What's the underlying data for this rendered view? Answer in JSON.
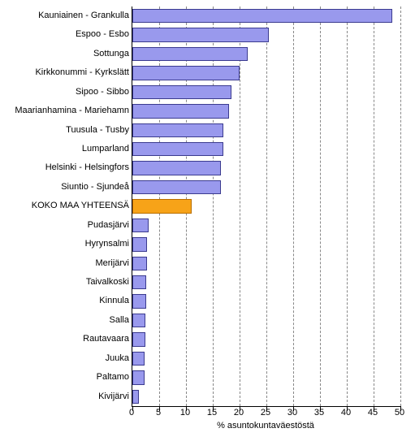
{
  "chart_data": {
    "type": "bar",
    "orientation": "horizontal",
    "xlabel": "% asuntokuntaväestöstä",
    "ylabel": "",
    "xlim": [
      0,
      50
    ],
    "xticks": [
      0,
      5,
      10,
      15,
      20,
      25,
      30,
      35,
      40,
      45,
      50
    ],
    "categories": [
      "Kauniainen - Grankulla",
      "Espoo - Esbo",
      "Sottunga",
      "Kirkkonummi - Kyrkslätt",
      "Sipoo - Sibbo",
      "Maarianhamina - Mariehamn",
      "Tuusula - Tusby",
      "Lumparland",
      "Helsinki - Helsingfors",
      "Siuntio - Sjundeå",
      "KOKO MAA YHTEENSÄ",
      "Pudasjärvi",
      "Hyrynsalmi",
      "Merijärvi",
      "Taivalkoski",
      "Kinnula",
      "Salla",
      "Rautavaara",
      "Juuka",
      "Paltamo",
      "Kivijärvi"
    ],
    "values": [
      48.5,
      25.5,
      21.5,
      20,
      18.5,
      18,
      17,
      17,
      16.5,
      16.5,
      11,
      3,
      2.8,
      2.7,
      2.5,
      2.5,
      2.4,
      2.4,
      2.3,
      2.2,
      1.2
    ],
    "highlight_index": 10,
    "colors": {
      "bar_fill": "#9999ed",
      "bar_border": "#3b3b8f",
      "highlight_fill": "#f7a318",
      "highlight_border": "#b86e00"
    }
  }
}
